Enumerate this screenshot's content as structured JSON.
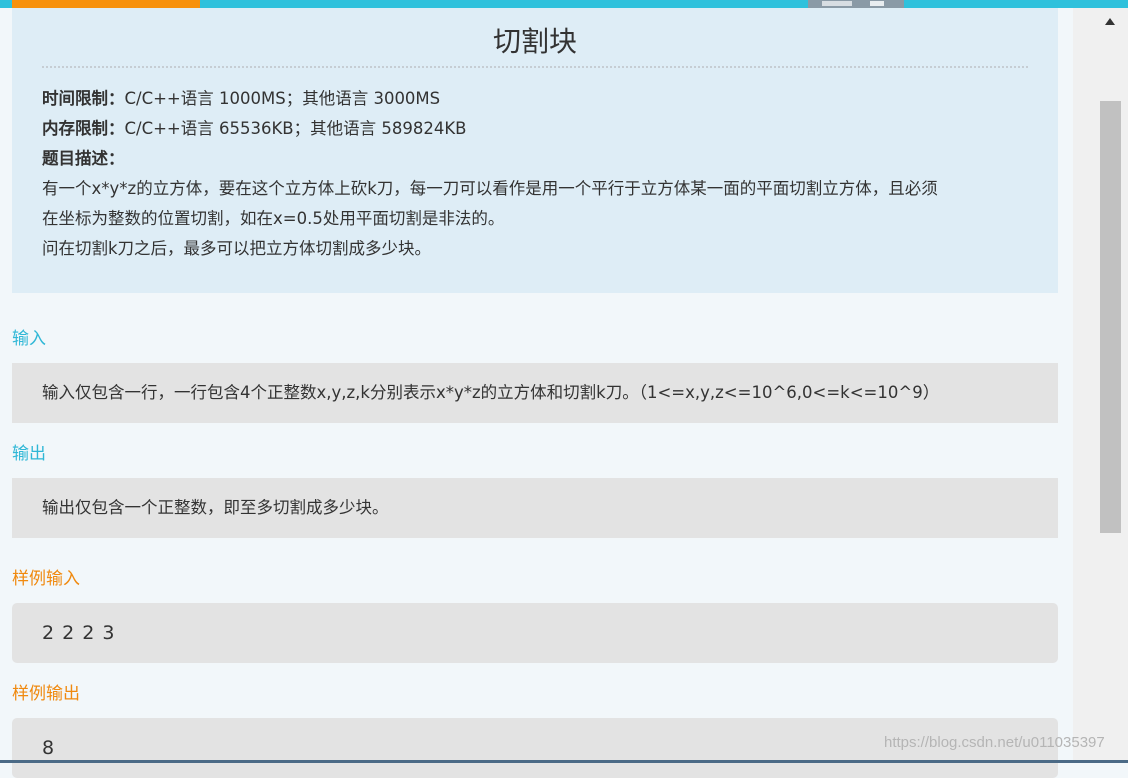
{
  "problem": {
    "title": "切割块",
    "time_limit_label": "时间限制：",
    "time_limit_value": "C/C++语言 1000MS；其他语言 3000MS",
    "memory_limit_label": "内存限制：",
    "memory_limit_value": "C/C++语言 65536KB；其他语言 589824KB",
    "description_label": "题目描述：",
    "description_line1": "有一个x*y*z的立方体，要在这个立方体上砍k刀，每一刀可以看作是用一个平行于立方体某一面的平面切割立方体，且必须",
    "description_line2": "在坐标为整数的位置切割，如在x=0.5处用平面切割是非法的。",
    "description_line3": "问在切割k刀之后，最多可以把立方体切割成多少块。"
  },
  "sections": {
    "input_label": "输入",
    "input_text": "输入仅包含一行，一行包含4个正整数x,y,z,k分别表示x*y*z的立方体和切割k刀。（1<=x,y,z<=10^6,0<=k<=10^9）",
    "output_label": "输出",
    "output_text": "输出仅包含一个正整数，即至多切割成多少块。",
    "sample_input_label": "样例输入",
    "sample_input_value": "2 2 2 3",
    "sample_output_label": "样例输出",
    "sample_output_value": "8"
  },
  "watermark": "https://blog.csdn.net/u011035397",
  "colors": {
    "accent_blue": "#2fc1dc",
    "accent_orange": "#f7910c",
    "panel_bg": "#deedf6"
  }
}
